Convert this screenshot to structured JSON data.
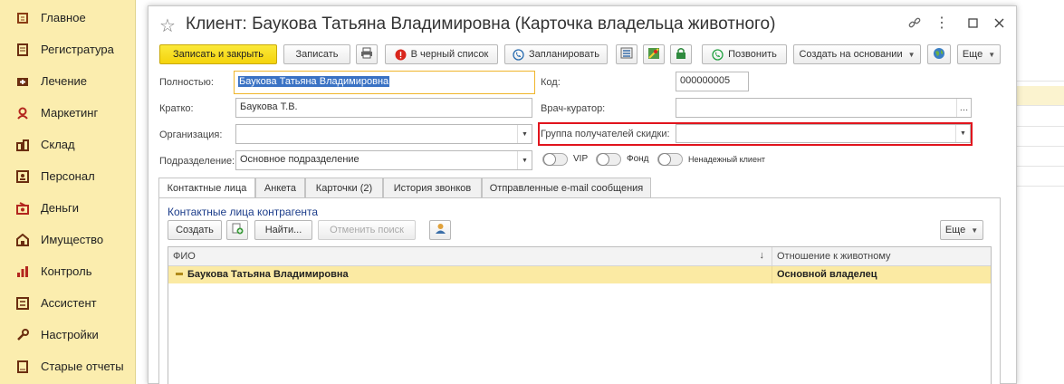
{
  "sidebar": {
    "items": [
      {
        "label": "Главное",
        "icon": "home-icon"
      },
      {
        "label": "Регистратура",
        "icon": "registry-icon"
      },
      {
        "label": "Лечение",
        "icon": "treatment-icon"
      },
      {
        "label": "Маркетинг",
        "icon": "marketing-icon"
      },
      {
        "label": "Склад",
        "icon": "warehouse-icon"
      },
      {
        "label": "Персонал",
        "icon": "personnel-icon"
      },
      {
        "label": "Деньги",
        "icon": "money-icon"
      },
      {
        "label": "Имущество",
        "icon": "property-icon"
      },
      {
        "label": "Контроль",
        "icon": "control-icon"
      },
      {
        "label": "Ассистент",
        "icon": "assistant-icon"
      },
      {
        "label": "Настройки",
        "icon": "wrench-icon"
      },
      {
        "label": "Старые отчеты",
        "icon": "old-reports-icon"
      }
    ]
  },
  "window": {
    "title": "Клиент: Баукова Татьяна Владимировна (Карточка владельца животного)"
  },
  "toolbar": {
    "save_close": "Записать и закрыть",
    "save": "Записать",
    "blacklist": "В черный список",
    "schedule": "Запланировать",
    "call": "Позвонить",
    "create_based": "Создать на основании",
    "more": "Еще"
  },
  "form": {
    "full_name_label": "Полностью:",
    "full_name_value": "Баукова Татьяна Владимировна",
    "short_name_label": "Кратко:",
    "short_name_value": "Баукова Т.В.",
    "organization_label": "Организация:",
    "organization_value": "",
    "department_label": "Подразделение:",
    "department_value": "Основное подразделение",
    "code_label": "Код:",
    "code_value": "000000005",
    "curator_label": "Врач-куратор:",
    "curator_value": "",
    "discount_group_label": "Группа получателей скидки:",
    "discount_group_value": "",
    "toggles": {
      "vip": "VIP",
      "fond": "Фонд",
      "unreliable": "Ненадежный клиент"
    }
  },
  "tabs": [
    {
      "label": "Контактные лица",
      "active": true
    },
    {
      "label": "Анкета",
      "active": false
    },
    {
      "label": "Карточки (2)",
      "active": false
    },
    {
      "label": "История звонков",
      "active": false
    },
    {
      "label": "Отправленные e-mail сообщения",
      "active": false
    }
  ],
  "contacts": {
    "section_title": "Контактные лица контрагента",
    "create": "Создать",
    "find": "Найти...",
    "cancel_search": "Отменить поиск",
    "more": "Еще",
    "columns": [
      "ФИО",
      "Отношение к животному"
    ],
    "sort_indicator": "↓",
    "rows": [
      {
        "name": "Баукова Татьяна Владимировна",
        "relation": "Основной владелец"
      }
    ]
  },
  "colors": {
    "sidebar_bg": "#fbedae",
    "primary_button": "#f4d30c",
    "highlight_border": "#e1141d",
    "selected_row": "#fbeaa3",
    "section_title": "#1b3c8a"
  }
}
